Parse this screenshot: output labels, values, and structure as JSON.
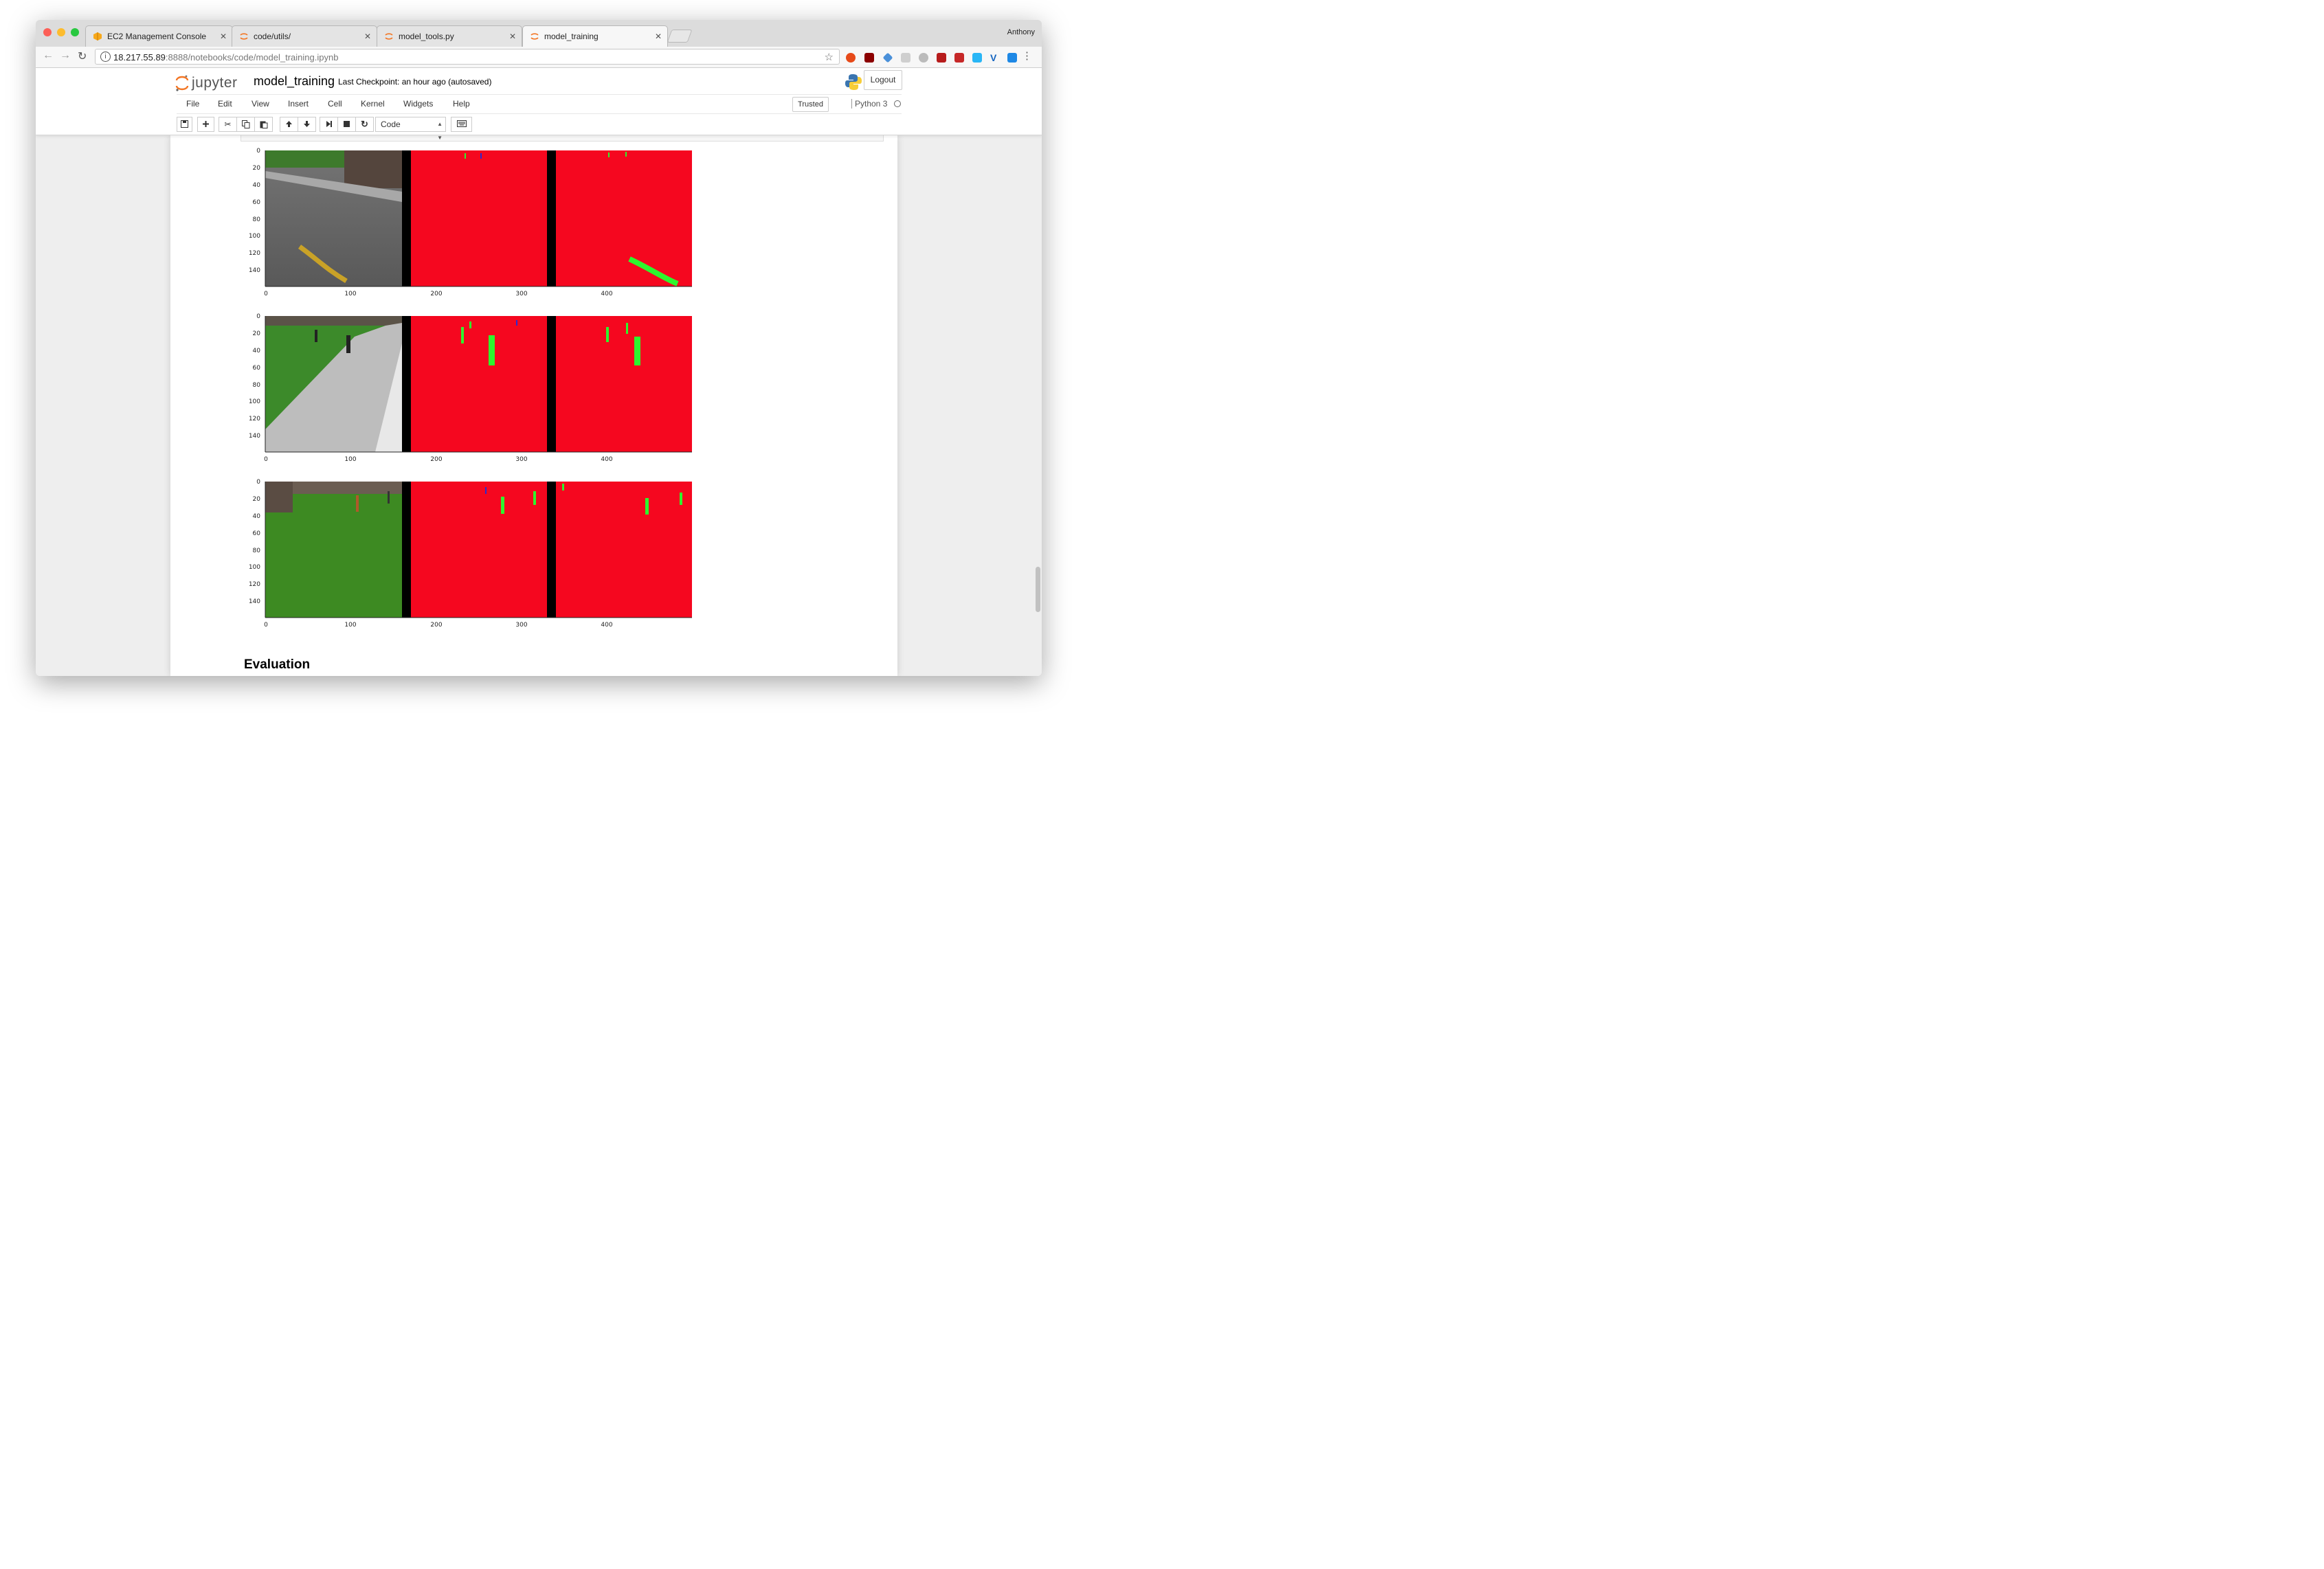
{
  "browser": {
    "tabs": [
      {
        "label": "EC2 Management Console",
        "icon": "aws-icon"
      },
      {
        "label": "code/utils/",
        "icon": "jupyter-icon"
      },
      {
        "label": "model_tools.py",
        "icon": "jupyter-icon"
      },
      {
        "label": "model_training",
        "icon": "jupyter-icon",
        "active": true
      }
    ],
    "profile": "Anthony",
    "url_host": "18.217.55.89",
    "url_path": ":8888/notebooks/code/model_training.ipynb"
  },
  "jupyter": {
    "logo_text": "jupyter",
    "notebook_name": "model_training",
    "checkpoint": "Last Checkpoint: an hour ago (autosaved)",
    "logout": "Logout",
    "menu": [
      "File",
      "Edit",
      "View",
      "Insert",
      "Cell",
      "Kernel",
      "Widgets",
      "Help"
    ],
    "trusted": "Trusted",
    "kernel": "Python 3",
    "cell_type": "Code"
  },
  "plots": {
    "y_ticks": [
      "0",
      "20",
      "40",
      "60",
      "80",
      "100",
      "120",
      "140"
    ],
    "x_ticks": [
      "0",
      "100",
      "200",
      "300",
      "400"
    ]
  },
  "section_heading": "Evaluation",
  "colors": {
    "mask_red": "#f5071f",
    "mask_green": "#2ef52e",
    "separator": "#000000",
    "jupyter_orange": "#f37726"
  }
}
